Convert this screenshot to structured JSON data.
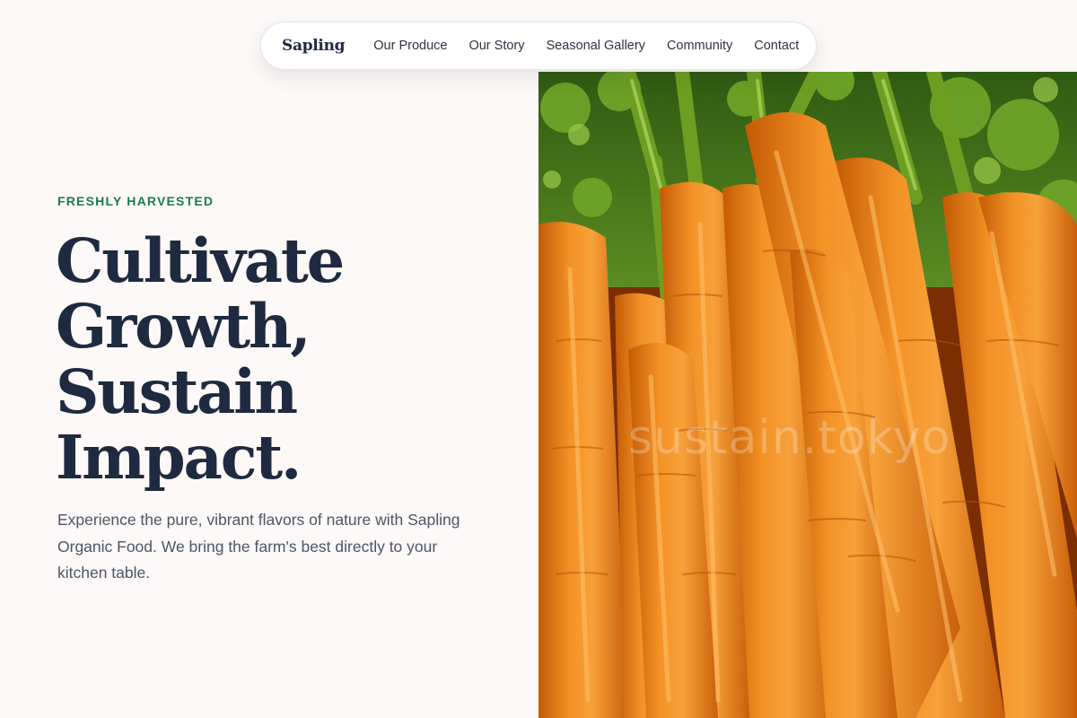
{
  "nav": {
    "brand": "Sapling",
    "links": [
      "Our Produce",
      "Our Story",
      "Seasonal Gallery",
      "Community",
      "Contact"
    ]
  },
  "hero": {
    "eyebrow": "FRESHLY HARVESTED",
    "headline_lines": [
      "Cultivate",
      "Growth,",
      "Sustain",
      "Impact."
    ],
    "description": "Experience the pure, vibrant flavors of nature with Sapling Organic Food. We bring the farm's best directly to your kitchen table.",
    "image": {
      "subject": "carrots-photo",
      "watermark": "sustain.tokyo"
    }
  },
  "colors": {
    "background": "#fdf9f8",
    "accent": "#1b7a55",
    "heading": "#1e2a3f",
    "body_text": "#4d5566",
    "carrot_orange": "#ee8a18",
    "leaf_green": "#4f8e1e"
  }
}
